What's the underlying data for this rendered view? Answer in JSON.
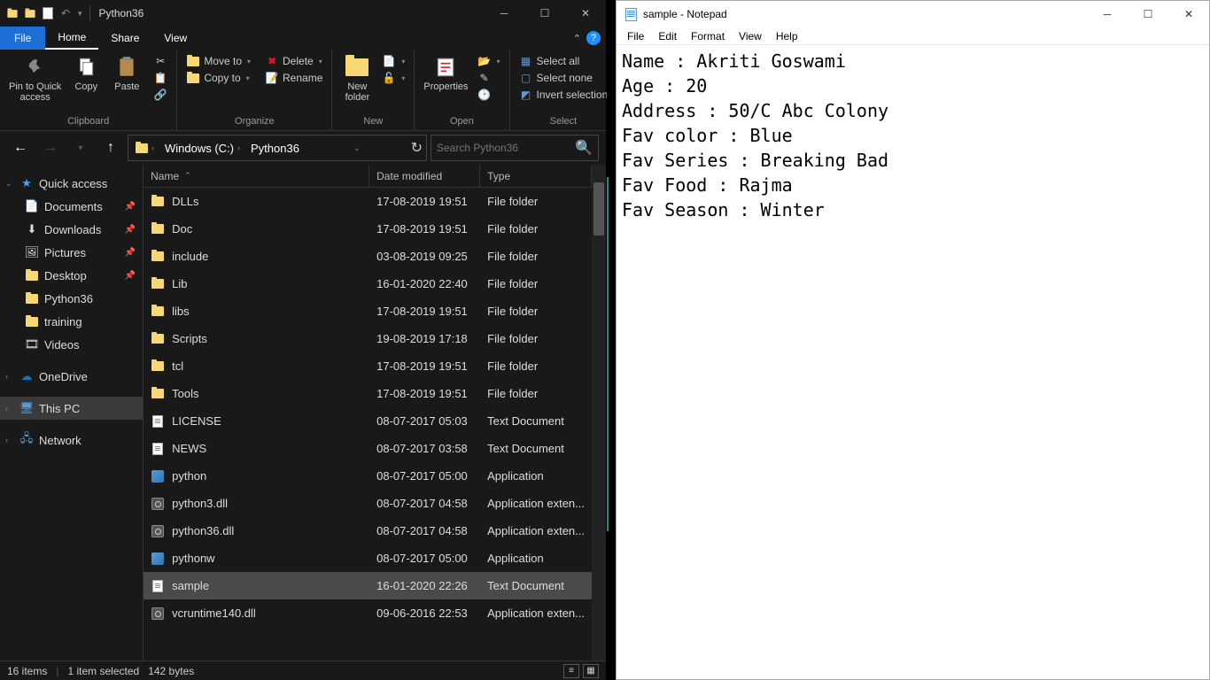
{
  "explorer": {
    "titlebar": {
      "title": "Python36"
    },
    "menu": {
      "file": "File",
      "home": "Home",
      "share": "Share",
      "view": "View"
    },
    "ribbon": {
      "clipboard": {
        "label": "Clipboard",
        "pin": "Pin to Quick\naccess",
        "copy": "Copy",
        "paste": "Paste"
      },
      "organize": {
        "label": "Organize",
        "moveto": "Move to",
        "copyto": "Copy to",
        "delete": "Delete",
        "rename": "Rename"
      },
      "new": {
        "label": "New",
        "newfolder": "New\nfolder"
      },
      "open": {
        "label": "Open",
        "properties": "Properties"
      },
      "select": {
        "label": "Select",
        "selectall": "Select all",
        "selectnone": "Select none",
        "invert": "Invert selection"
      }
    },
    "address": {
      "crumbs": [
        "Windows (C:)",
        "Python36"
      ],
      "search_placeholder": "Search Python36"
    },
    "sidebar": {
      "quickaccess": "Quick access",
      "items": [
        "Documents",
        "Downloads",
        "Pictures",
        "Desktop",
        "Python36",
        "training",
        "Videos"
      ],
      "onedrive": "OneDrive",
      "thispc": "This PC",
      "network": "Network"
    },
    "columns": {
      "name": "Name",
      "date": "Date modified",
      "type": "Type"
    },
    "files": [
      {
        "name": "DLLs",
        "date": "17-08-2019 19:51",
        "type": "File folder",
        "kind": "folder"
      },
      {
        "name": "Doc",
        "date": "17-08-2019 19:51",
        "type": "File folder",
        "kind": "folder"
      },
      {
        "name": "include",
        "date": "03-08-2019 09:25",
        "type": "File folder",
        "kind": "folder"
      },
      {
        "name": "Lib",
        "date": "16-01-2020 22:40",
        "type": "File folder",
        "kind": "folder"
      },
      {
        "name": "libs",
        "date": "17-08-2019 19:51",
        "type": "File folder",
        "kind": "folder"
      },
      {
        "name": "Scripts",
        "date": "19-08-2019 17:18",
        "type": "File folder",
        "kind": "folder"
      },
      {
        "name": "tcl",
        "date": "17-08-2019 19:51",
        "type": "File folder",
        "kind": "folder"
      },
      {
        "name": "Tools",
        "date": "17-08-2019 19:51",
        "type": "File folder",
        "kind": "folder"
      },
      {
        "name": "LICENSE",
        "date": "08-07-2017 05:03",
        "type": "Text Document",
        "kind": "doc"
      },
      {
        "name": "NEWS",
        "date": "08-07-2017 03:58",
        "type": "Text Document",
        "kind": "doc"
      },
      {
        "name": "python",
        "date": "08-07-2017 05:00",
        "type": "Application",
        "kind": "app"
      },
      {
        "name": "python3.dll",
        "date": "08-07-2017 04:58",
        "type": "Application exten...",
        "kind": "ext"
      },
      {
        "name": "python36.dll",
        "date": "08-07-2017 04:58",
        "type": "Application exten...",
        "kind": "ext"
      },
      {
        "name": "pythonw",
        "date": "08-07-2017 05:00",
        "type": "Application",
        "kind": "app"
      },
      {
        "name": "sample",
        "date": "16-01-2020 22:26",
        "type": "Text Document",
        "kind": "doc",
        "selected": true
      },
      {
        "name": "vcruntime140.dll",
        "date": "09-06-2016 22:53",
        "type": "Application exten...",
        "kind": "ext"
      }
    ],
    "status": {
      "count": "16 items",
      "selected": "1 item selected",
      "size": "142 bytes"
    }
  },
  "notepad": {
    "title": "sample - Notepad",
    "menu": [
      "File",
      "Edit",
      "Format",
      "View",
      "Help"
    ],
    "content": "Name : Akriti Goswami\nAge : 20\nAddress : 50/C Abc Colony\nFav color : Blue\nFav Series : Breaking Bad\nFav Food : Rajma\nFav Season : Winter"
  }
}
